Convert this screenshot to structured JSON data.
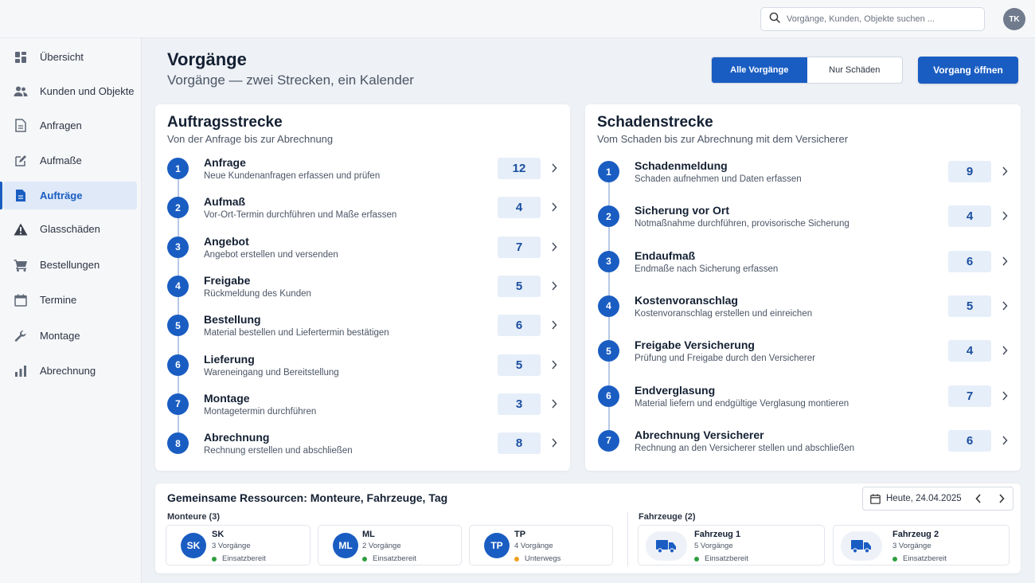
{
  "topbar": {
    "search_placeholder": "Vorgänge, Kunden, Objekte suchen ...",
    "user_initials": "TK"
  },
  "sidebar": {
    "items": [
      {
        "label": "Übersicht",
        "icon": "dashboard-icon",
        "active": false
      },
      {
        "label": "Kunden und Objekte",
        "icon": "users-icon",
        "active": false
      },
      {
        "label": "Anfragen",
        "icon": "document-icon",
        "active": false
      },
      {
        "label": "Aufmaße",
        "icon": "edit-icon",
        "active": false
      },
      {
        "label": "Aufträge",
        "icon": "document-filled-icon",
        "active": true
      },
      {
        "label": "Glasschäden",
        "icon": "warning-icon",
        "active": false
      },
      {
        "label": "Bestellungen",
        "icon": "cart-icon",
        "active": false
      },
      {
        "label": "Termine",
        "icon": "calendar-icon",
        "active": false
      },
      {
        "label": "Montage",
        "icon": "wrench-icon",
        "active": false
      },
      {
        "label": "Abrechnung",
        "icon": "bar-chart-icon",
        "active": false
      }
    ]
  },
  "header": {
    "title": "Vorgänge",
    "subtitle": "Vorgänge — zwei Strecken, ein Kalender",
    "filter_all": "Alle Vorgänge",
    "filter_damage": "Nur Schäden",
    "open_button": "Vorgang öffnen"
  },
  "order_track": {
    "title": "Auftragsstrecke",
    "subtitle": "Von der Anfrage bis zur Abrechnung",
    "steps": [
      {
        "num": "1",
        "title": "Anfrage",
        "desc": "Neue Kundenanfragen erfassen und prüfen",
        "count": "12"
      },
      {
        "num": "2",
        "title": "Aufmaß",
        "desc": "Vor-Ort-Termin durchführen und Maße erfassen",
        "count": "4"
      },
      {
        "num": "3",
        "title": "Angebot",
        "desc": "Angebot erstellen und versenden",
        "count": "7"
      },
      {
        "num": "4",
        "title": "Freigabe",
        "desc": "Rückmeldung des Kunden",
        "count": "5"
      },
      {
        "num": "5",
        "title": "Bestellung",
        "desc": "Material bestellen und Liefertermin bestätigen",
        "count": "6"
      },
      {
        "num": "6",
        "title": "Lieferung",
        "desc": "Wareneingang und Bereitstellung",
        "count": "5"
      },
      {
        "num": "7",
        "title": "Montage",
        "desc": "Montagetermin durchführen",
        "count": "3"
      },
      {
        "num": "8",
        "title": "Abrechnung",
        "desc": "Rechnung erstellen und abschließen",
        "count": "8"
      }
    ]
  },
  "damage_track": {
    "title": "Schadenstrecke",
    "subtitle": "Vom Schaden bis zur Abrechnung mit dem Versicherer",
    "steps": [
      {
        "num": "1",
        "title": "Schadenmeldung",
        "desc": "Schaden aufnehmen und Daten erfassen",
        "count": "9"
      },
      {
        "num": "2",
        "title": "Sicherung vor Ort",
        "desc": "Notmaßnahme durchführen, provisorische Sicherung",
        "count": "4"
      },
      {
        "num": "3",
        "title": "Endaufmaß",
        "desc": "Endmaße nach Sicherung erfassen",
        "count": "6"
      },
      {
        "num": "4",
        "title": "Kostenvoranschlag",
        "desc": "Kostenvoranschlag erstellen und einreichen",
        "count": "5"
      },
      {
        "num": "5",
        "title": "Freigabe Versicherung",
        "desc": "Prüfung und Freigabe durch den Versicherer",
        "count": "4"
      },
      {
        "num": "6",
        "title": "Endverglasung",
        "desc": "Material liefern und endgültige Verglasung montieren",
        "count": "7"
      },
      {
        "num": "7",
        "title": "Abrechnung Versicherer",
        "desc": "Rechnung an den Versicherer stellen und abschließen",
        "count": "6"
      }
    ]
  },
  "resources": {
    "title": "Gemeinsame Ressourcen: Monteure, Fahrzeuge, Tag",
    "date": "Heute, 24.04.2025",
    "fitters_label": "Monteure (3)",
    "vehicles_label": "Fahrzeuge (2)",
    "fitters": [
      {
        "initials": "SK",
        "name": "SK",
        "count": "3 Vorgänge",
        "status": "Einsatzbereit",
        "status_color": "#2e9e3f"
      },
      {
        "initials": "ML",
        "name": "ML",
        "count": "2 Vorgänge",
        "status": "Einsatzbereit",
        "status_color": "#2e9e3f"
      },
      {
        "initials": "TP",
        "name": "TP",
        "count": "4 Vorgänge",
        "status": "Unterwegs",
        "status_color": "#f0a020"
      }
    ],
    "vehicles": [
      {
        "name": "Fahrzeug 1",
        "count": "5 Vorgänge",
        "status": "Einsatzbereit",
        "status_color": "#2e9e3f"
      },
      {
        "name": "Fahrzeug 2",
        "count": "3 Vorgänge",
        "status": "Einsatzbereit",
        "status_color": "#2e9e3f"
      }
    ]
  },
  "colors": {
    "accent": "#1a5dc2",
    "count_bg": "#e6eef9",
    "ready": "#2e9e3f",
    "on_the_way": "#f0a020"
  }
}
